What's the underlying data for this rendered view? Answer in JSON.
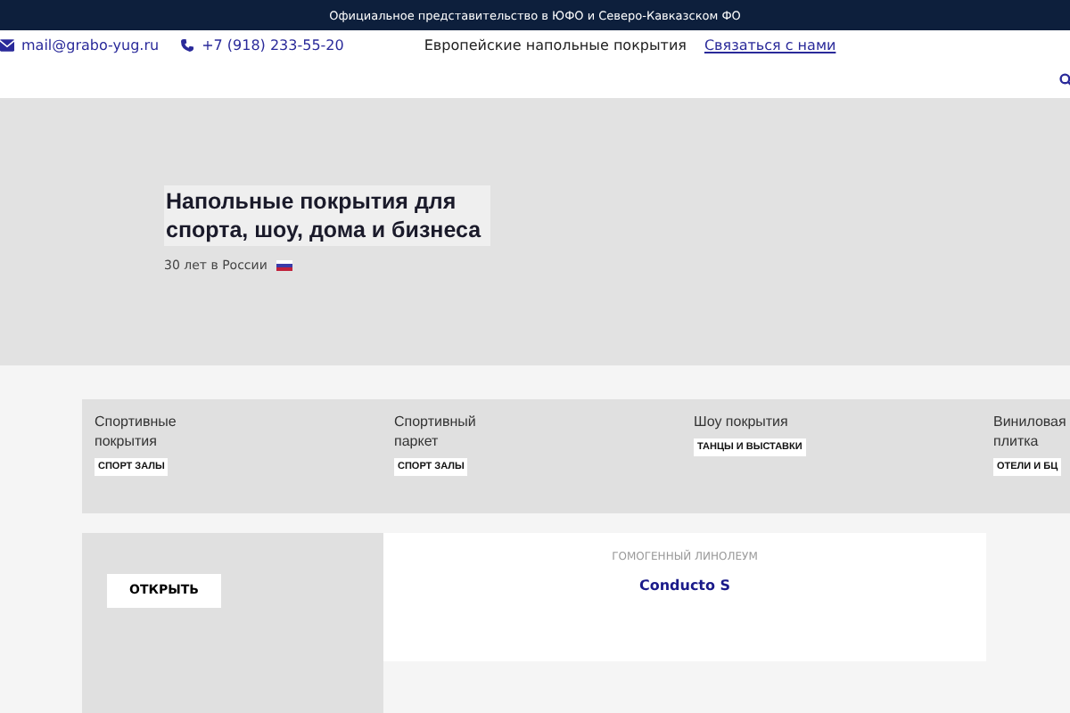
{
  "top_bar": {
    "text": "Официальное представительство в ЮФО и Северо-Кавказском ФО"
  },
  "contacts": {
    "email": "mail@grabo-yug.ru",
    "phone": "+7 (918) 233-55-20",
    "tagline": "Европейские напольные покрытия",
    "contact_link": "Связаться с нами"
  },
  "hero": {
    "title": "Напольные покрытия для спорта, шоу, дома и бизнеса",
    "subtitle": "30 лет в России"
  },
  "categories": [
    {
      "title": "Спортивные покрытия",
      "tag": "СПОРТ ЗАЛЫ"
    },
    {
      "title": "Спортивный паркет",
      "tag": "СПОРТ ЗАЛЫ"
    },
    {
      "title": "Шоу покрытия",
      "tag": "ТАНЦЫ И ВЫСТАВКИ"
    },
    {
      "title": "Виниловая плитка",
      "tag": "ОТЕЛИ И БЦ"
    }
  ],
  "product": {
    "button": "ОТКРЫТЬ",
    "category": "ГОМОГЕННЫЙ ЛИНОЛЕУМ",
    "name": "Conducto S"
  }
}
